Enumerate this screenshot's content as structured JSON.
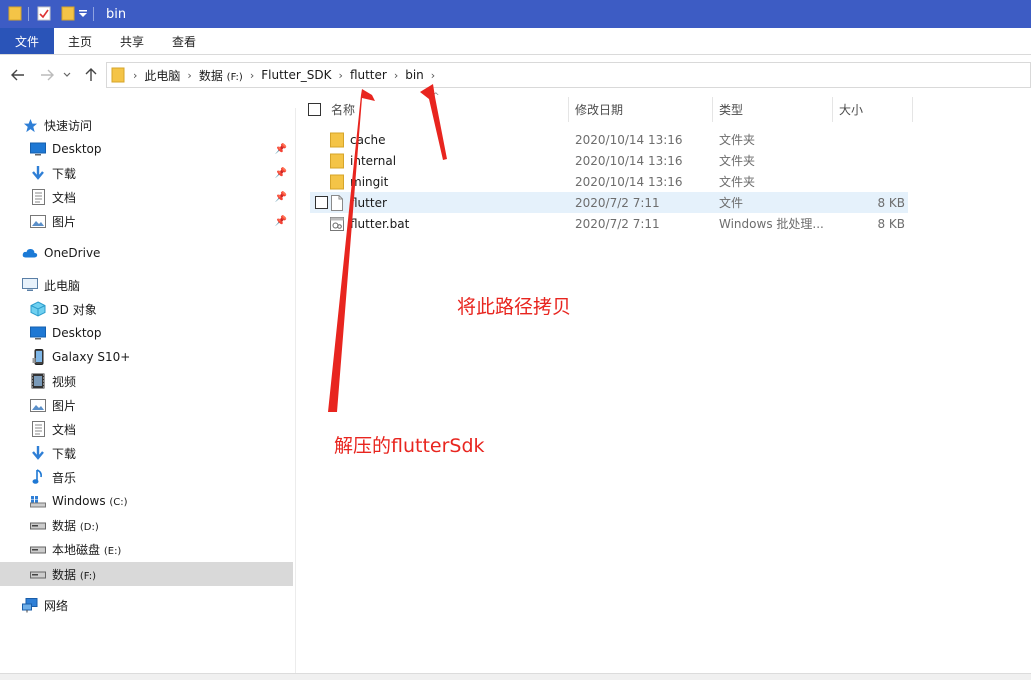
{
  "window": {
    "title": "bin"
  },
  "ribbon": {
    "tabs": [
      "文件",
      "主页",
      "共享",
      "查看"
    ]
  },
  "address": {
    "crumbs": [
      {
        "label": "此电脑"
      },
      {
        "label": "数据",
        "suffix": "(F:)"
      },
      {
        "label": "Flutter_SDK"
      },
      {
        "label": "flutter"
      },
      {
        "label": "bin"
      }
    ]
  },
  "sidebar": {
    "quick_access": "快速访问",
    "quick_items": [
      {
        "label": "Desktop",
        "icon": "desktop-icon"
      },
      {
        "label": "下载",
        "icon": "download-icon"
      },
      {
        "label": "文档",
        "icon": "document-icon"
      },
      {
        "label": "图片",
        "icon": "picture-icon"
      }
    ],
    "onedrive": "OneDrive",
    "this_pc": "此电脑",
    "pc_items": [
      {
        "label": "3D 对象",
        "icon": "3d-objects-icon"
      },
      {
        "label": "Desktop",
        "icon": "desktop-icon"
      },
      {
        "label": "Galaxy S10+",
        "icon": "phone-icon"
      },
      {
        "label": "视频",
        "icon": "video-icon"
      },
      {
        "label": "图片",
        "icon": "picture-icon"
      },
      {
        "label": "文档",
        "icon": "document-icon"
      },
      {
        "label": "下载",
        "icon": "download-icon"
      },
      {
        "label": "音乐",
        "icon": "music-icon"
      },
      {
        "label": "Windows",
        "suffix": "(C:)",
        "icon": "windows-drive-icon"
      },
      {
        "label": "数据",
        "suffix": "(D:)",
        "icon": "drive-icon"
      },
      {
        "label": "本地磁盘",
        "suffix": "(E:)",
        "icon": "drive-icon"
      },
      {
        "label": "数据",
        "suffix": "(F:)",
        "icon": "drive-icon"
      }
    ],
    "network": "网络"
  },
  "columns": {
    "name": "名称",
    "date": "修改日期",
    "type": "类型",
    "size": "大小"
  },
  "files": [
    {
      "name": "cache",
      "date": "2020/10/14 13:16",
      "type": "文件夹",
      "size": "",
      "icon": "folder-icon"
    },
    {
      "name": "internal",
      "date": "2020/10/14 13:16",
      "type": "文件夹",
      "size": "",
      "icon": "folder-icon"
    },
    {
      "name": "mingit",
      "date": "2020/10/14 13:16",
      "type": "文件夹",
      "size": "",
      "icon": "folder-icon"
    },
    {
      "name": "flutter",
      "date": "2020/7/2 7:11",
      "type": "文件",
      "size": "8 KB",
      "icon": "file-icon"
    },
    {
      "name": "flutter.bat",
      "date": "2020/7/2 7:11",
      "type": "Windows 批处理...",
      "size": "8 KB",
      "icon": "bat-file-icon"
    }
  ],
  "annotations": {
    "copy_path": "将此路径拷贝",
    "unzipped": "解压的flutterSdk"
  },
  "colors": {
    "titlebar": "#3d5cc4",
    "file_tab": "#2a54b8",
    "annotation": "#e8251f",
    "folder": "#f4c447",
    "hover_row": "#e5f1fb"
  }
}
